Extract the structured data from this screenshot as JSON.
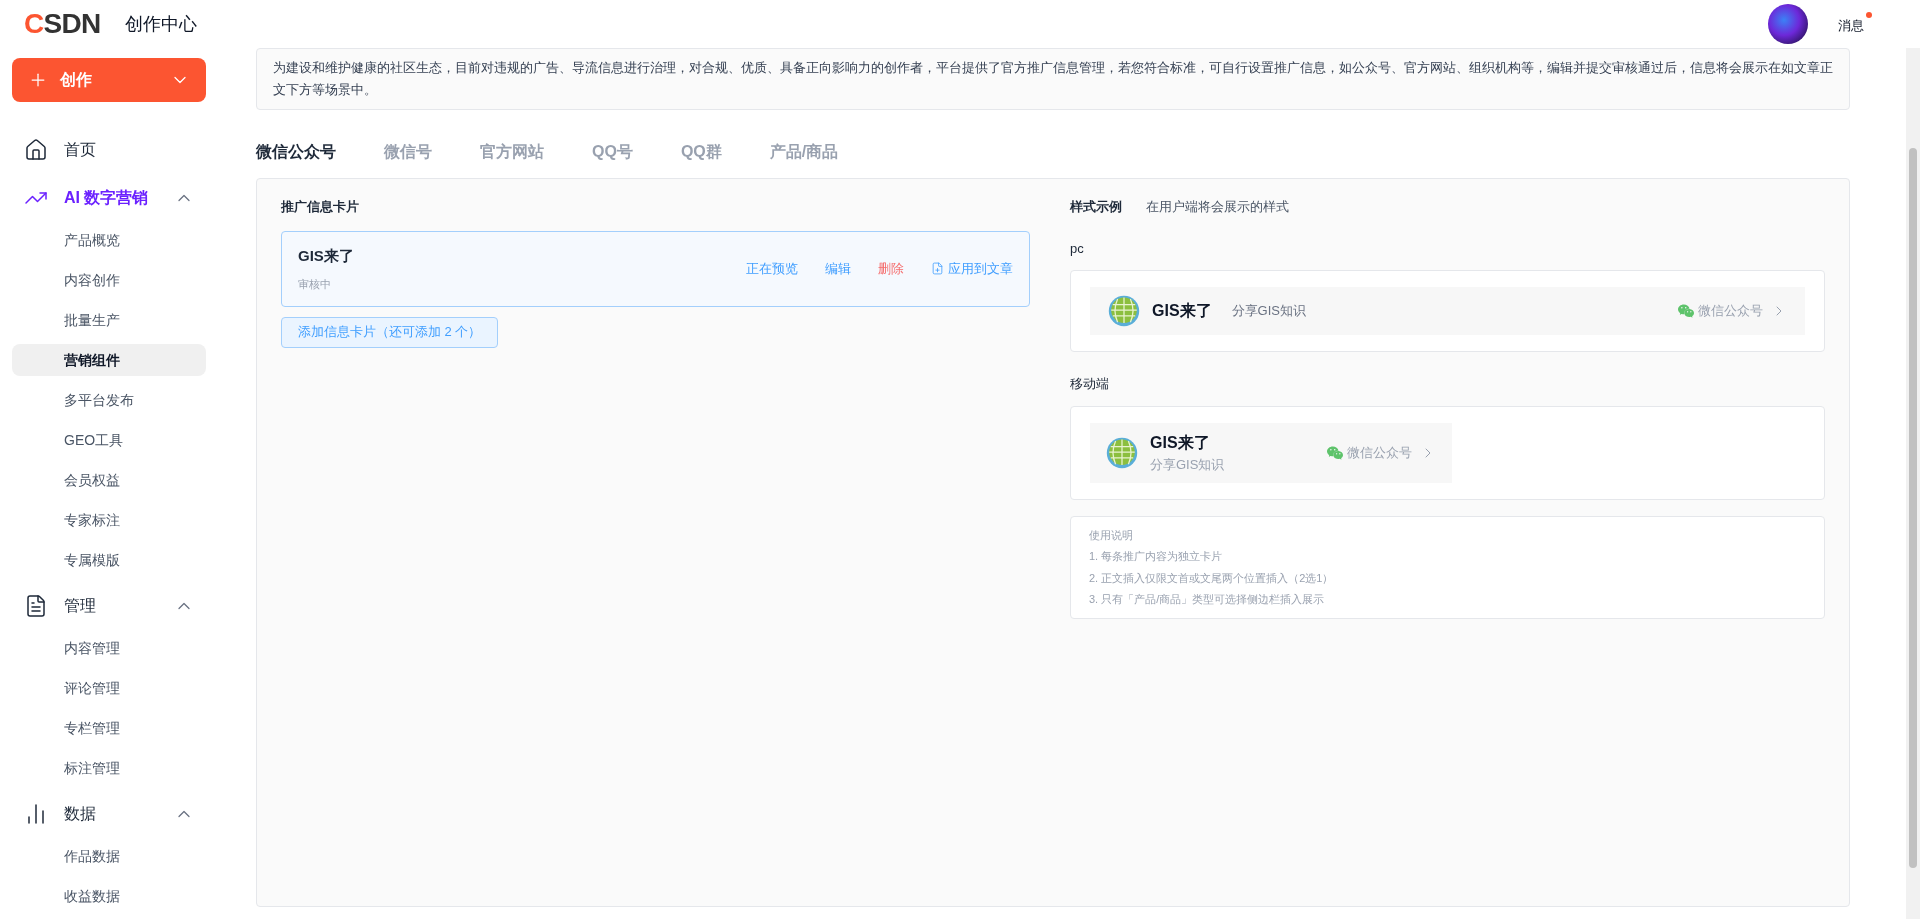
{
  "header": {
    "logo": "CSDN",
    "title": "创作中心",
    "messages": {
      "label": "消息",
      "unread": true
    }
  },
  "sidebar": {
    "create_button": "创作",
    "groups": [
      {
        "label": "首页",
        "active": false
      },
      {
        "label": "AI 数字营销",
        "expanded": true,
        "active": true,
        "children": [
          {
            "label": "产品概览",
            "selected": false
          },
          {
            "label": "内容创作",
            "selected": false
          },
          {
            "label": "批量生产",
            "selected": false
          },
          {
            "label": "营销组件",
            "selected": true
          },
          {
            "label": "多平台发布",
            "selected": false
          },
          {
            "label": "GEO工具",
            "selected": false
          },
          {
            "label": "会员权益",
            "selected": false
          },
          {
            "label": "专家标注",
            "selected": false
          },
          {
            "label": "专属模版",
            "selected": false
          }
        ]
      },
      {
        "label": "管理",
        "expanded": true,
        "active": false,
        "children": [
          {
            "label": "内容管理",
            "selected": false
          },
          {
            "label": "评论管理",
            "selected": false
          },
          {
            "label": "专栏管理",
            "selected": false
          },
          {
            "label": "标注管理",
            "selected": false
          }
        ]
      },
      {
        "label": "数据",
        "expanded": true,
        "active": false,
        "children": [
          {
            "label": "作品数据",
            "selected": false
          },
          {
            "label": "收益数据",
            "selected": false
          }
        ]
      }
    ]
  },
  "notice": "为建设和维护健康的社区生态，目前对违规的广告、导流信息进行治理，对合规、优质、具备正向影响力的创作者，平台提供了官方推广信息管理，若您符合标准，可自行设置推广信息，如公众号、官方网站、组织机构等，编辑并提交审核通过后，信息将会展示在如文章正文下方等场景中。",
  "tabs": [
    {
      "label": "微信公众号",
      "selected": true
    },
    {
      "label": "微信号",
      "selected": false
    },
    {
      "label": "官方网站",
      "selected": false
    },
    {
      "label": "QQ号",
      "selected": false
    },
    {
      "label": "QQ群",
      "selected": false
    },
    {
      "label": "产品/商品",
      "selected": false
    }
  ],
  "cards_section": {
    "title": "推广信息卡片",
    "cards": [
      {
        "name": "GIS来了",
        "status": "审核中",
        "actions": [
          {
            "label": "正在预览",
            "kind": "link"
          },
          {
            "label": "编辑",
            "kind": "link"
          },
          {
            "label": "删除",
            "kind": "danger"
          },
          {
            "label": "应用到文章",
            "kind": "apply"
          }
        ]
      }
    ],
    "add_button": "添加信息卡片（还可添加 2 个）"
  },
  "preview": {
    "title": "样式示例",
    "subtitle": "在用户端将会展示的样式",
    "pc": {
      "label": "pc",
      "name": "GIS来了",
      "desc": "分享GIS知识",
      "platform": "微信公众号"
    },
    "mobile": {
      "label": "移动端",
      "name": "GIS来了",
      "desc": "分享GIS知识",
      "platform": "微信公众号"
    },
    "instructions": {
      "title": "使用说明",
      "items": [
        "1. 每条推广内容为独立卡片",
        "2. 正文插入仅限文首或文尾两个位置插入（2选1）",
        "3. 只有「产品/商品」类型可选择侧边栏插入展示"
      ]
    }
  }
}
